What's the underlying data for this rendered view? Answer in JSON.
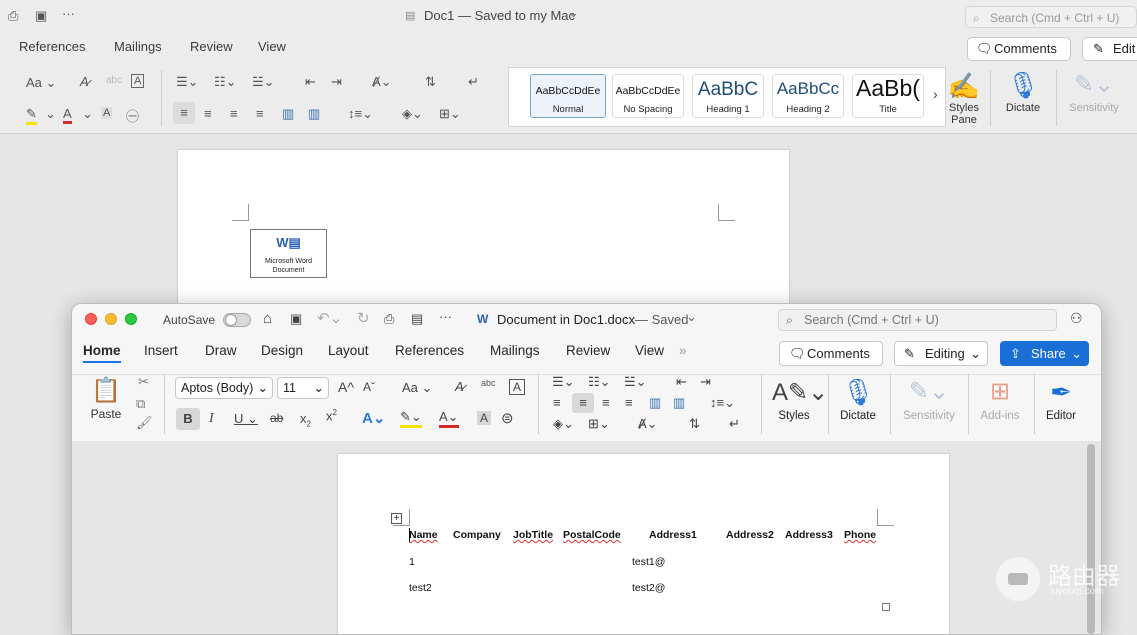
{
  "bg_window": {
    "title": "Doc1 — Saved to my Mac",
    "title_chevron": "⌄",
    "search_placeholder": "Search (Cmd + Ctrl + U)",
    "tabs": [
      "References",
      "Mailings",
      "Review",
      "View"
    ],
    "comments_label": "Comments",
    "edit_label": "Edit",
    "styles": [
      {
        "preview": "AaBbCcDdEe",
        "name": "Normal"
      },
      {
        "preview": "AaBbCcDdEe",
        "name": "No Spacing"
      },
      {
        "preview": "AaBbC",
        "name": "Heading 1"
      },
      {
        "preview": "AaBbCc",
        "name": "Heading 2"
      },
      {
        "preview": "AaBb(",
        "name": "Title"
      }
    ],
    "styles_pane_label": "Styles Pane",
    "dictate_label": "Dictate",
    "sensitivity_label": "Sensitivity",
    "embed_label_1": "Microsoft Word",
    "embed_label_2": "Document"
  },
  "front_window": {
    "autosave_label": "AutoSave",
    "doc_title": "Document in Doc1.docx",
    "saved_status": "— Saved",
    "search_placeholder": "Search (Cmd + Ctrl + U)",
    "tabs": [
      "Home",
      "Insert",
      "Draw",
      "Design",
      "Layout",
      "References",
      "Mailings",
      "Review",
      "View"
    ],
    "more_tabs": "»",
    "comments_label": "Comments",
    "editing_label": "Editing",
    "share_label": "Share",
    "paste_label": "Paste",
    "font_name": "Aptos (Body)",
    "font_size": "11",
    "styles_label": "Styles",
    "dictate_label": "Dictate",
    "sensitivity_label": "Sensitivity",
    "addins_label": "Add-ins",
    "editor_label": "Editor"
  },
  "table": {
    "headers": [
      "Name",
      "Company",
      "JobTitle",
      "PostalCode",
      "Address1",
      "Address2",
      "Address3",
      "Phone"
    ],
    "rows": [
      {
        "name": "1",
        "address1": "test1@"
      },
      {
        "name": "test2",
        "address1": "test2@"
      }
    ]
  },
  "watermark": {
    "title": "路由器",
    "subtitle": "luyouqi.com"
  },
  "colors": {
    "accent": "#1a73e8",
    "share": "#1a6fd6",
    "highlight": "#f5e400",
    "font_color": "#d22a2a"
  }
}
